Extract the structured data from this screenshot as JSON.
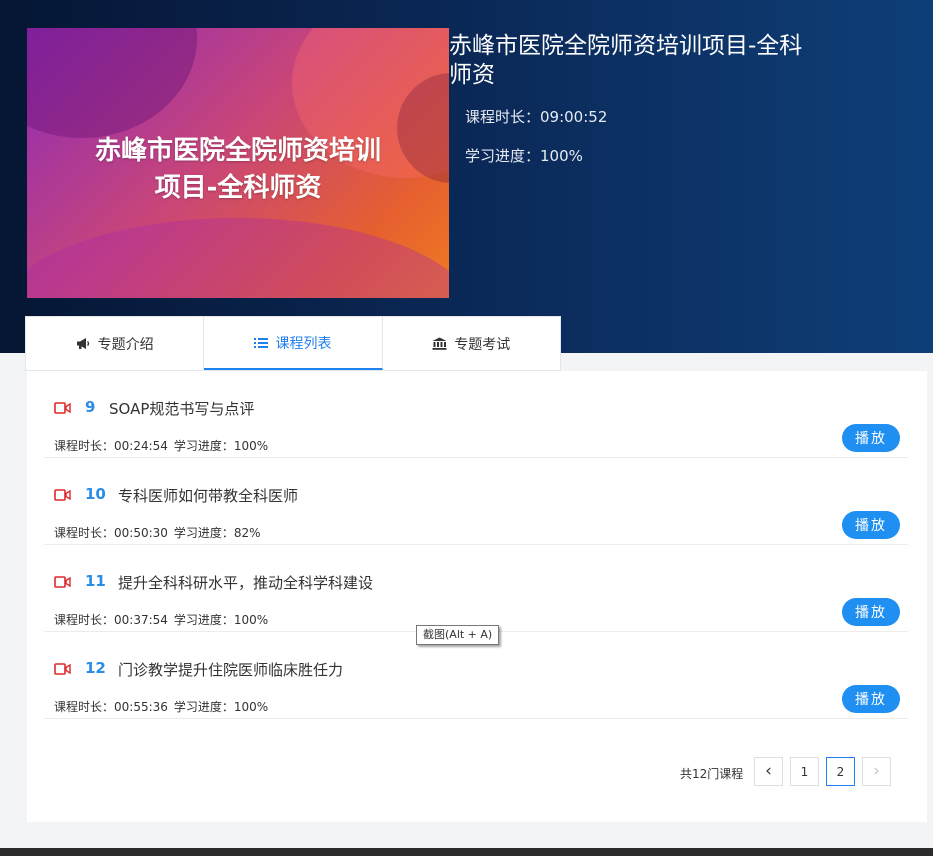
{
  "course": {
    "cover_title": "赤峰市医院全院师资培训项目-全科师资",
    "title": "赤峰市医院全院师资培训项目-全科师资",
    "duration_text": "课程时长：09:00:52",
    "progress_text": "学习进度：100%"
  },
  "tabs": [
    {
      "label": "专题介绍",
      "icon": "megaphone-icon",
      "active": false
    },
    {
      "label": "课程列表",
      "icon": "list-icon",
      "active": true
    },
    {
      "label": "专题考试",
      "icon": "bank-icon",
      "active": false
    }
  ],
  "lessons": [
    {
      "num": "9",
      "title": "SOAP规范书写与点评",
      "duration": "课程时长：00:24:54",
      "progress": "学习进度：100%",
      "play_label": "播放"
    },
    {
      "num": "10",
      "title": "专科医师如何带教全科医师",
      "duration": "课程时长：00:50:30",
      "progress": "学习进度：82%",
      "play_label": "播放"
    },
    {
      "num": "11",
      "title": "提升全科科研水平，推动全科学科建设",
      "duration": "课程时长：00:37:54",
      "progress": "学习进度：100%",
      "play_label": "播放"
    },
    {
      "num": "12",
      "title": "门诊教学提升住院医师临床胜任力",
      "duration": "课程时长：00:55:36",
      "progress": "学习进度：100%",
      "play_label": "播放"
    }
  ],
  "pagination": {
    "total_text": "共12门课程",
    "prev": "‹",
    "next": "›",
    "pages": [
      "1",
      "2"
    ],
    "current": "2"
  },
  "tooltip": "截图(Alt + A)",
  "colors": {
    "accent": "#1f80f0",
    "play_button": "#1f8ff2",
    "lesson_number": "#2a8be8",
    "video_icon": "#e0282a"
  }
}
